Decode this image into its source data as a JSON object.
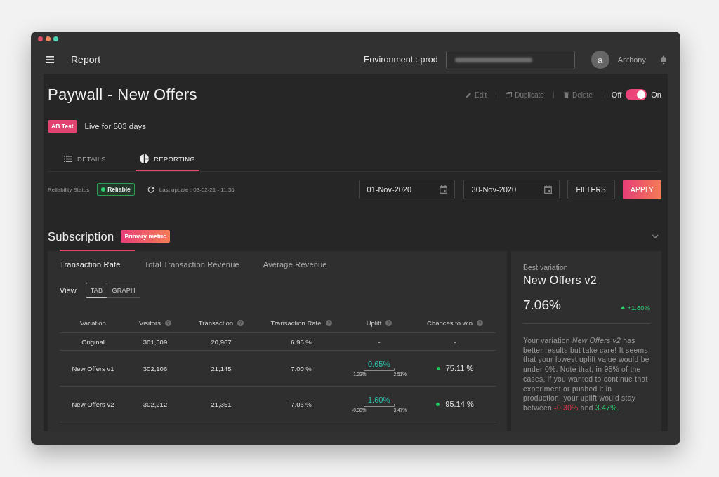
{
  "window": {
    "controls": [
      {
        "kind": "close"
      },
      {
        "kind": "minimize"
      },
      {
        "kind": "maximize"
      }
    ]
  },
  "top_bar": {
    "title": "Report",
    "environment": "Environment : prod",
    "account_field": {
      "redacted": true
    },
    "user": {
      "initial": "a",
      "name": "Anthony"
    }
  },
  "header": {
    "title": "Paywall - New Offers",
    "actions": [
      {
        "kind": "edit",
        "label": "Edit",
        "disabled": true
      },
      {
        "kind": "duplicate",
        "label": "Duplicate",
        "disabled": true
      },
      {
        "kind": "delete",
        "label": "Delete",
        "disabled": true
      }
    ],
    "toggle": {
      "off_label": "Off",
      "on_label": "On",
      "on": true
    },
    "badge": "AB Test",
    "status": "Live for 503 days"
  },
  "tabs": [
    {
      "kind": "details",
      "label": "DETAILS",
      "selected": false
    },
    {
      "kind": "reporting",
      "label": "REPORTING",
      "selected": true
    }
  ],
  "filters_bar": {
    "reliability_label": "Reliability Status",
    "reliability": "Reliable",
    "last_update": "Last update : 03-02-21 - 11:36",
    "start_date": "01-Nov-2020",
    "end_date": "30-Nov-2020",
    "buttons": [
      {
        "kind": "secondary",
        "label": "FILTERS"
      },
      {
        "kind": "primary",
        "label": "APPLY"
      }
    ]
  },
  "section": {
    "title": "Subscription",
    "badge": "Primary metric"
  },
  "metric_tabs": [
    {
      "label": "Transaction Rate",
      "selected": true
    },
    {
      "label": "Total Transaction Revenue",
      "selected": false
    },
    {
      "label": "Average Revenue",
      "selected": false
    }
  ],
  "view": {
    "label": "View",
    "options": [
      {
        "label": "TAB",
        "selected": true
      },
      {
        "label": "GRAPH",
        "selected": false
      }
    ]
  },
  "table": {
    "columns": [
      {
        "label": "Variation",
        "help": false
      },
      {
        "label": "Visitors",
        "help": true
      },
      {
        "label": "Transaction",
        "help": true
      },
      {
        "label": "Transaction Rate",
        "help": true
      },
      {
        "label": "Uplift",
        "help": true
      },
      {
        "label": "Chances to win",
        "help": true
      }
    ],
    "rows": [
      {
        "variation": "Original",
        "visitors": "301,509",
        "transaction": "20,967",
        "rate": "6.95 %",
        "uplift": {
          "kind": "none",
          "value": "-"
        },
        "chances": {
          "value": "-"
        }
      },
      {
        "variation": "New Offers v1",
        "visitors": "302,106",
        "transaction": "21,145",
        "rate": "7.00 %",
        "uplift": {
          "kind": "interval",
          "value": "0.65%",
          "low": "-1.23%",
          "high": "2.51%"
        },
        "chances": {
          "value": "75.11 %",
          "color": "#22c55e"
        }
      },
      {
        "variation": "New Offers v2",
        "visitors": "302,212",
        "transaction": "21,351",
        "rate": "7.06 %",
        "uplift": {
          "kind": "interval",
          "value": "1.60%",
          "low": "-0.30%",
          "high": "3.47%"
        },
        "chances": {
          "value": "95.14 %",
          "color": "#22c55e"
        }
      }
    ]
  },
  "best_variation": {
    "label": "Best variation",
    "name": "New Offers v2",
    "rate": "7.06%",
    "positive": true,
    "uplift": "+1.60%",
    "message": [
      {
        "kind": "text",
        "text": "Your variation *New Offers v2* has better results but take care! It seems that your lowest uplift value would be under 0%. Note that, in 95% of the cases, if you wanted to continue that experiment or pushed it in production, your uplift would stay between "
      },
      {
        "kind": "negative",
        "text": "-0.30%"
      },
      {
        "kind": "text",
        "text": " and "
      },
      {
        "kind": "positive",
        "text": "3.47%."
      }
    ]
  }
}
